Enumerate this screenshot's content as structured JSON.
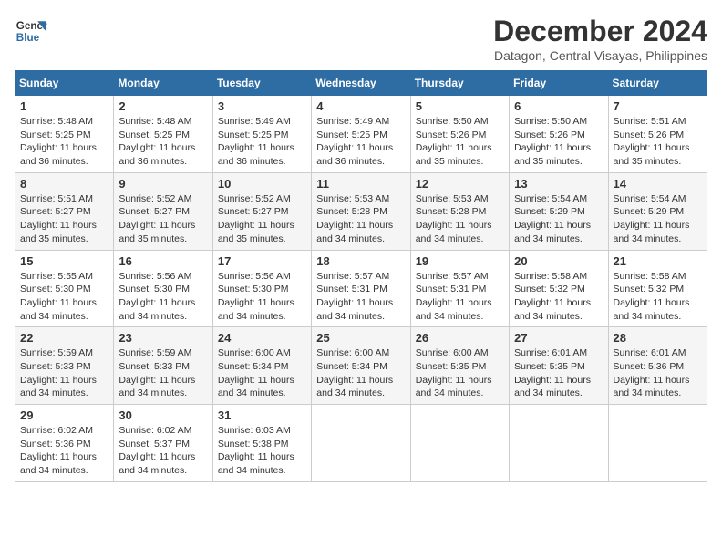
{
  "header": {
    "logo_line1": "General",
    "logo_line2": "Blue",
    "title": "December 2024",
    "subtitle": "Datagon, Central Visayas, Philippines"
  },
  "calendar": {
    "headers": [
      "Sunday",
      "Monday",
      "Tuesday",
      "Wednesday",
      "Thursday",
      "Friday",
      "Saturday"
    ],
    "weeks": [
      [
        {
          "day": "",
          "info": ""
        },
        {
          "day": "2",
          "info": "Sunrise: 5:48 AM\nSunset: 5:25 PM\nDaylight: 11 hours\nand 36 minutes."
        },
        {
          "day": "3",
          "info": "Sunrise: 5:49 AM\nSunset: 5:25 PM\nDaylight: 11 hours\nand 36 minutes."
        },
        {
          "day": "4",
          "info": "Sunrise: 5:49 AM\nSunset: 5:25 PM\nDaylight: 11 hours\nand 36 minutes."
        },
        {
          "day": "5",
          "info": "Sunrise: 5:50 AM\nSunset: 5:26 PM\nDaylight: 11 hours\nand 35 minutes."
        },
        {
          "day": "6",
          "info": "Sunrise: 5:50 AM\nSunset: 5:26 PM\nDaylight: 11 hours\nand 35 minutes."
        },
        {
          "day": "7",
          "info": "Sunrise: 5:51 AM\nSunset: 5:26 PM\nDaylight: 11 hours\nand 35 minutes."
        }
      ],
      [
        {
          "day": "8",
          "info": "Sunrise: 5:51 AM\nSunset: 5:27 PM\nDaylight: 11 hours\nand 35 minutes."
        },
        {
          "day": "9",
          "info": "Sunrise: 5:52 AM\nSunset: 5:27 PM\nDaylight: 11 hours\nand 35 minutes."
        },
        {
          "day": "10",
          "info": "Sunrise: 5:52 AM\nSunset: 5:27 PM\nDaylight: 11 hours\nand 35 minutes."
        },
        {
          "day": "11",
          "info": "Sunrise: 5:53 AM\nSunset: 5:28 PM\nDaylight: 11 hours\nand 34 minutes."
        },
        {
          "day": "12",
          "info": "Sunrise: 5:53 AM\nSunset: 5:28 PM\nDaylight: 11 hours\nand 34 minutes."
        },
        {
          "day": "13",
          "info": "Sunrise: 5:54 AM\nSunset: 5:29 PM\nDaylight: 11 hours\nand 34 minutes."
        },
        {
          "day": "14",
          "info": "Sunrise: 5:54 AM\nSunset: 5:29 PM\nDaylight: 11 hours\nand 34 minutes."
        }
      ],
      [
        {
          "day": "15",
          "info": "Sunrise: 5:55 AM\nSunset: 5:30 PM\nDaylight: 11 hours\nand 34 minutes."
        },
        {
          "day": "16",
          "info": "Sunrise: 5:56 AM\nSunset: 5:30 PM\nDaylight: 11 hours\nand 34 minutes."
        },
        {
          "day": "17",
          "info": "Sunrise: 5:56 AM\nSunset: 5:30 PM\nDaylight: 11 hours\nand 34 minutes."
        },
        {
          "day": "18",
          "info": "Sunrise: 5:57 AM\nSunset: 5:31 PM\nDaylight: 11 hours\nand 34 minutes."
        },
        {
          "day": "19",
          "info": "Sunrise: 5:57 AM\nSunset: 5:31 PM\nDaylight: 11 hours\nand 34 minutes."
        },
        {
          "day": "20",
          "info": "Sunrise: 5:58 AM\nSunset: 5:32 PM\nDaylight: 11 hours\nand 34 minutes."
        },
        {
          "day": "21",
          "info": "Sunrise: 5:58 AM\nSunset: 5:32 PM\nDaylight: 11 hours\nand 34 minutes."
        }
      ],
      [
        {
          "day": "22",
          "info": "Sunrise: 5:59 AM\nSunset: 5:33 PM\nDaylight: 11 hours\nand 34 minutes."
        },
        {
          "day": "23",
          "info": "Sunrise: 5:59 AM\nSunset: 5:33 PM\nDaylight: 11 hours\nand 34 minutes."
        },
        {
          "day": "24",
          "info": "Sunrise: 6:00 AM\nSunset: 5:34 PM\nDaylight: 11 hours\nand 34 minutes."
        },
        {
          "day": "25",
          "info": "Sunrise: 6:00 AM\nSunset: 5:34 PM\nDaylight: 11 hours\nand 34 minutes."
        },
        {
          "day": "26",
          "info": "Sunrise: 6:00 AM\nSunset: 5:35 PM\nDaylight: 11 hours\nand 34 minutes."
        },
        {
          "day": "27",
          "info": "Sunrise: 6:01 AM\nSunset: 5:35 PM\nDaylight: 11 hours\nand 34 minutes."
        },
        {
          "day": "28",
          "info": "Sunrise: 6:01 AM\nSunset: 5:36 PM\nDaylight: 11 hours\nand 34 minutes."
        }
      ],
      [
        {
          "day": "29",
          "info": "Sunrise: 6:02 AM\nSunset: 5:36 PM\nDaylight: 11 hours\nand 34 minutes."
        },
        {
          "day": "30",
          "info": "Sunrise: 6:02 AM\nSunset: 5:37 PM\nDaylight: 11 hours\nand 34 minutes."
        },
        {
          "day": "31",
          "info": "Sunrise: 6:03 AM\nSunset: 5:38 PM\nDaylight: 11 hours\nand 34 minutes."
        },
        {
          "day": "",
          "info": ""
        },
        {
          "day": "",
          "info": ""
        },
        {
          "day": "",
          "info": ""
        },
        {
          "day": "",
          "info": ""
        }
      ]
    ],
    "week1_day1": {
      "day": "1",
      "info": "Sunrise: 5:48 AM\nSunset: 5:25 PM\nDaylight: 11 hours\nand 36 minutes."
    }
  }
}
